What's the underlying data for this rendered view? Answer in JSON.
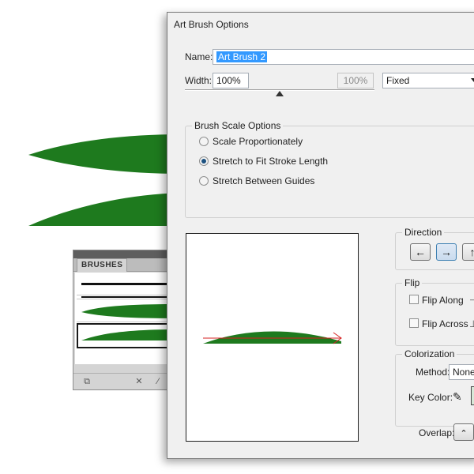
{
  "dialog": {
    "title": "Art Brush Options",
    "name_label": "Name:",
    "name_value": "Art Brush 2",
    "width_label": "Width:",
    "width_value": "100%",
    "width_max_value": "100%",
    "width_mode": "Fixed",
    "brush_scale": {
      "title": "Brush Scale Options",
      "options": [
        "Scale Proportionately",
        "Stretch to Fit Stroke Length",
        "Stretch Between Guides"
      ],
      "selected_index": 1
    },
    "direction": {
      "title": "Direction",
      "buttons": [
        "left-arrow-icon",
        "right-arrow-icon",
        "up-arrow-icon"
      ],
      "selected": "right-arrow-icon"
    },
    "flip": {
      "title": "Flip",
      "along_label": "Flip Along",
      "across_label": "Flip Across",
      "along_checked": false,
      "across_checked": false
    },
    "colorization": {
      "title": "Colorization",
      "method_label": "Method:",
      "method_value": "None",
      "key_color_label": "Key Color:",
      "key_color": "#1e7a1e"
    },
    "overlap_label": "Overlap:"
  },
  "brushes_panel": {
    "tab_label": "BRUSHES",
    "brush_color": "#1e7a1e"
  },
  "colors": {
    "leaf": "#1e7a1e",
    "direction_arrow": "#d42020",
    "selection": "#3399ff"
  }
}
